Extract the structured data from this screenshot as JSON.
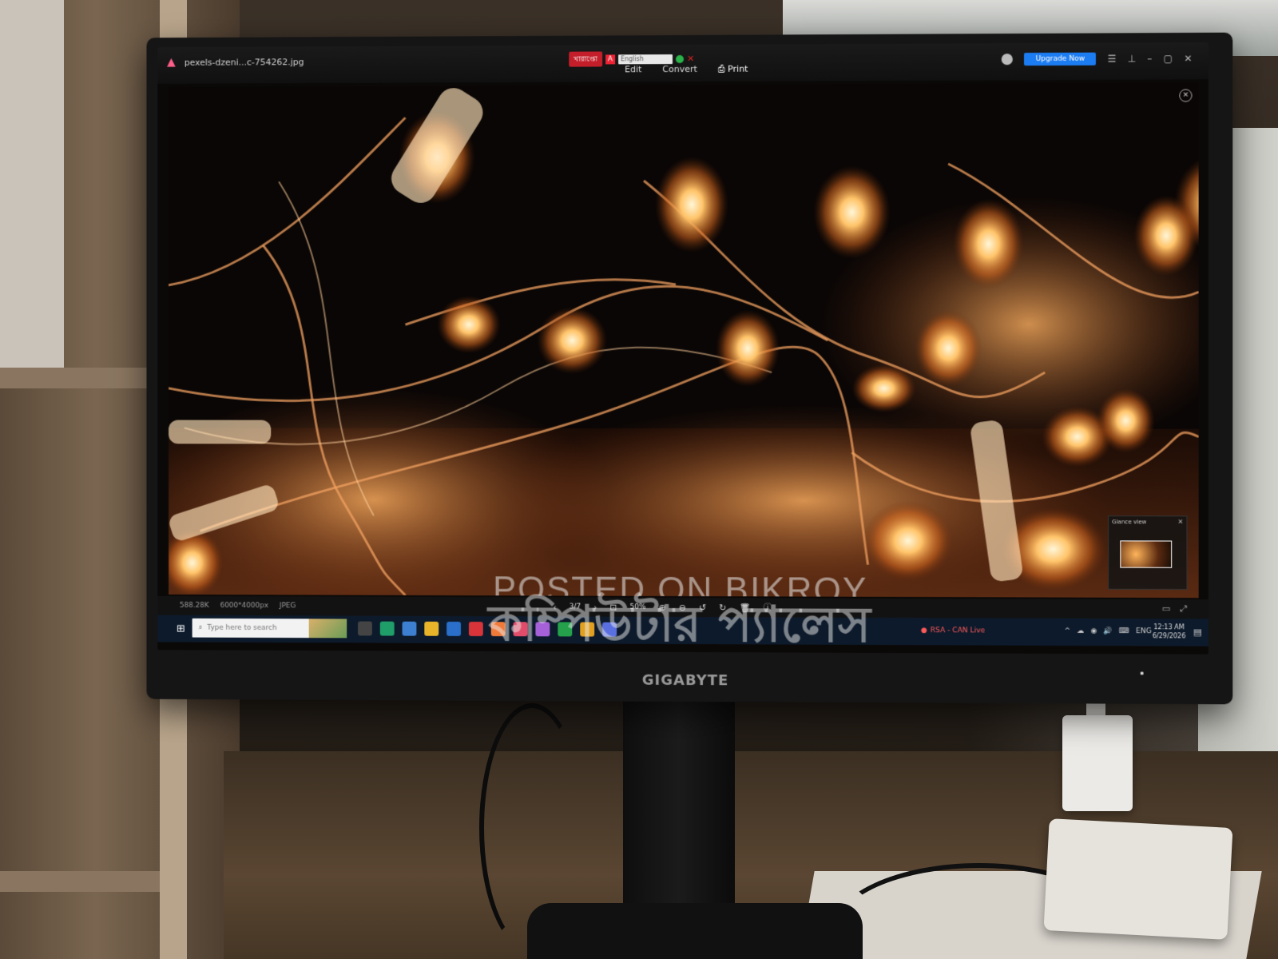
{
  "viewer": {
    "filename": "pexels-dzeni...c-754262.jpg",
    "menu": {
      "edit": "Edit",
      "convert": "Convert",
      "print": "Print"
    },
    "upgrade_label": "Upgrade Now",
    "overlay": {
      "bn_label": "খারাপ্তো",
      "lang": "English"
    }
  },
  "glance": {
    "title": "Glance view"
  },
  "status": {
    "filesize": "588.28K",
    "dimensions": "6000*4000px",
    "format": "JPEG",
    "page_counter": "3/7",
    "zoom": "50%"
  },
  "taskbar": {
    "search_placeholder": "Type here to search",
    "news": "RSA - CAN Live",
    "lang": "ENG",
    "time": "12:13 AM",
    "date": "6/29/2026"
  },
  "watermark": {
    "english": "POSTED ON BIKROY",
    "bangla": "কম্পিউটার প্যালেস"
  },
  "monitor": {
    "brand": "GIGABYTE"
  },
  "colors": {
    "accent_upgrade": "#1c7cf2",
    "taskbar": "#0d1a2b",
    "light_glow": "#ffb45a"
  }
}
